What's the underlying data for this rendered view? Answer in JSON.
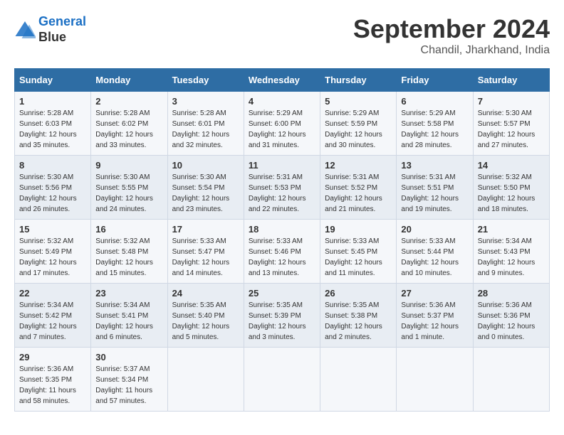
{
  "header": {
    "logo_line1": "General",
    "logo_line2": "Blue",
    "month": "September 2024",
    "location": "Chandil, Jharkhand, India"
  },
  "days_of_week": [
    "Sunday",
    "Monday",
    "Tuesday",
    "Wednesday",
    "Thursday",
    "Friday",
    "Saturday"
  ],
  "weeks": [
    [
      {
        "num": "1",
        "sunrise": "5:28 AM",
        "sunset": "6:03 PM",
        "daylight": "12 hours and 35 minutes."
      },
      {
        "num": "2",
        "sunrise": "5:28 AM",
        "sunset": "6:02 PM",
        "daylight": "12 hours and 33 minutes."
      },
      {
        "num": "3",
        "sunrise": "5:28 AM",
        "sunset": "6:01 PM",
        "daylight": "12 hours and 32 minutes."
      },
      {
        "num": "4",
        "sunrise": "5:29 AM",
        "sunset": "6:00 PM",
        "daylight": "12 hours and 31 minutes."
      },
      {
        "num": "5",
        "sunrise": "5:29 AM",
        "sunset": "5:59 PM",
        "daylight": "12 hours and 30 minutes."
      },
      {
        "num": "6",
        "sunrise": "5:29 AM",
        "sunset": "5:58 PM",
        "daylight": "12 hours and 28 minutes."
      },
      {
        "num": "7",
        "sunrise": "5:30 AM",
        "sunset": "5:57 PM",
        "daylight": "12 hours and 27 minutes."
      }
    ],
    [
      {
        "num": "8",
        "sunrise": "5:30 AM",
        "sunset": "5:56 PM",
        "daylight": "12 hours and 26 minutes."
      },
      {
        "num": "9",
        "sunrise": "5:30 AM",
        "sunset": "5:55 PM",
        "daylight": "12 hours and 24 minutes."
      },
      {
        "num": "10",
        "sunrise": "5:30 AM",
        "sunset": "5:54 PM",
        "daylight": "12 hours and 23 minutes."
      },
      {
        "num": "11",
        "sunrise": "5:31 AM",
        "sunset": "5:53 PM",
        "daylight": "12 hours and 22 minutes."
      },
      {
        "num": "12",
        "sunrise": "5:31 AM",
        "sunset": "5:52 PM",
        "daylight": "12 hours and 21 minutes."
      },
      {
        "num": "13",
        "sunrise": "5:31 AM",
        "sunset": "5:51 PM",
        "daylight": "12 hours and 19 minutes."
      },
      {
        "num": "14",
        "sunrise": "5:32 AM",
        "sunset": "5:50 PM",
        "daylight": "12 hours and 18 minutes."
      }
    ],
    [
      {
        "num": "15",
        "sunrise": "5:32 AM",
        "sunset": "5:49 PM",
        "daylight": "12 hours and 17 minutes."
      },
      {
        "num": "16",
        "sunrise": "5:32 AM",
        "sunset": "5:48 PM",
        "daylight": "12 hours and 15 minutes."
      },
      {
        "num": "17",
        "sunrise": "5:33 AM",
        "sunset": "5:47 PM",
        "daylight": "12 hours and 14 minutes."
      },
      {
        "num": "18",
        "sunrise": "5:33 AM",
        "sunset": "5:46 PM",
        "daylight": "12 hours and 13 minutes."
      },
      {
        "num": "19",
        "sunrise": "5:33 AM",
        "sunset": "5:45 PM",
        "daylight": "12 hours and 11 minutes."
      },
      {
        "num": "20",
        "sunrise": "5:33 AM",
        "sunset": "5:44 PM",
        "daylight": "12 hours and 10 minutes."
      },
      {
        "num": "21",
        "sunrise": "5:34 AM",
        "sunset": "5:43 PM",
        "daylight": "12 hours and 9 minutes."
      }
    ],
    [
      {
        "num": "22",
        "sunrise": "5:34 AM",
        "sunset": "5:42 PM",
        "daylight": "12 hours and 7 minutes."
      },
      {
        "num": "23",
        "sunrise": "5:34 AM",
        "sunset": "5:41 PM",
        "daylight": "12 hours and 6 minutes."
      },
      {
        "num": "24",
        "sunrise": "5:35 AM",
        "sunset": "5:40 PM",
        "daylight": "12 hours and 5 minutes."
      },
      {
        "num": "25",
        "sunrise": "5:35 AM",
        "sunset": "5:39 PM",
        "daylight": "12 hours and 3 minutes."
      },
      {
        "num": "26",
        "sunrise": "5:35 AM",
        "sunset": "5:38 PM",
        "daylight": "12 hours and 2 minutes."
      },
      {
        "num": "27",
        "sunrise": "5:36 AM",
        "sunset": "5:37 PM",
        "daylight": "12 hours and 1 minute."
      },
      {
        "num": "28",
        "sunrise": "5:36 AM",
        "sunset": "5:36 PM",
        "daylight": "12 hours and 0 minutes."
      }
    ],
    [
      {
        "num": "29",
        "sunrise": "5:36 AM",
        "sunset": "5:35 PM",
        "daylight": "11 hours and 58 minutes."
      },
      {
        "num": "30",
        "sunrise": "5:37 AM",
        "sunset": "5:34 PM",
        "daylight": "11 hours and 57 minutes."
      },
      null,
      null,
      null,
      null,
      null
    ]
  ]
}
